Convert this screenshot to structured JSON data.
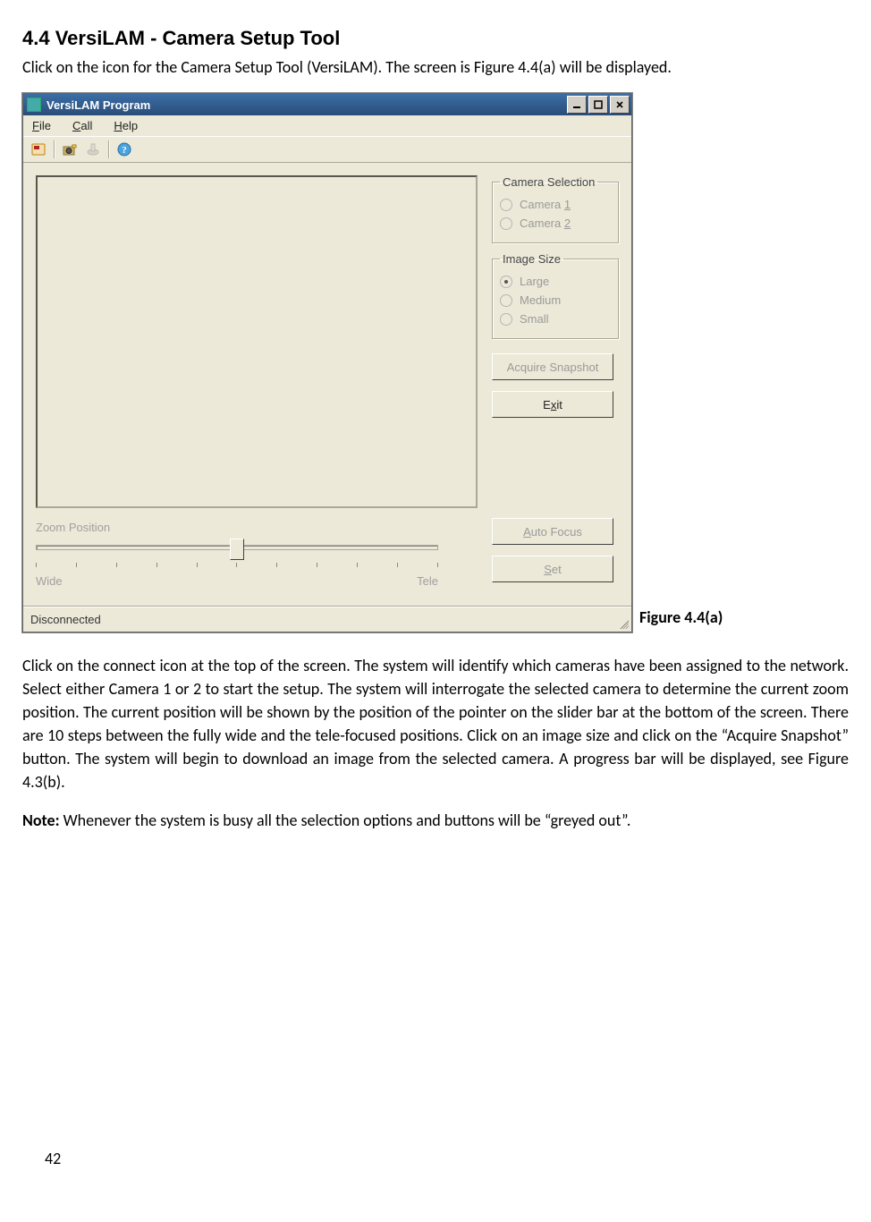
{
  "section_heading": "4.4 VersiLAM - Camera Setup Tool",
  "intro_text": "Click on the icon for the Camera Setup Tool (VersiLAM). The screen is Figure 4.4(a) will be displayed.",
  "figure_caption": "Figure 4.4(a)",
  "app": {
    "title": "VersiLAM Program",
    "menu": {
      "file": "File",
      "call": "Call",
      "help": "Help"
    },
    "groups": {
      "camera_selection": {
        "legend": "Camera Selection",
        "options": {
          "camera1": "Camera 1",
          "camera2": "Camera 2"
        }
      },
      "image_size": {
        "legend": "Image Size",
        "options": {
          "large": "Large",
          "medium": "Medium",
          "small": "Small"
        },
        "selected": "large"
      }
    },
    "buttons": {
      "acquire_snapshot": "Acquire Snapshot",
      "exit": "Exit",
      "auto_focus": "Auto Focus",
      "set": "Set"
    },
    "zoom": {
      "label": "Zoom Position",
      "wide": "Wide",
      "tele": "Tele"
    },
    "status": "Disconnected"
  },
  "body_paragraph": "Click on the connect icon at the top of the screen. The system will identify which cameras have been assigned to the network. Select either Camera 1 or 2 to start the setup. The system will interrogate the selected camera to determine the current zoom position. The current position will be shown by the position of the pointer on the slider bar at the bottom of the screen. There are 10 steps between the fully wide and the tele-focused positions. Click on an image size and click on the “Acquire Snapshot” button. The system will begin to download an image from the selected camera. A progress bar will be displayed, see Figure 4.3(b).",
  "note_label": "Note:",
  "note_text": " Whenever the system is busy all the selection options and buttons will be “greyed out”.",
  "page_number": "42"
}
